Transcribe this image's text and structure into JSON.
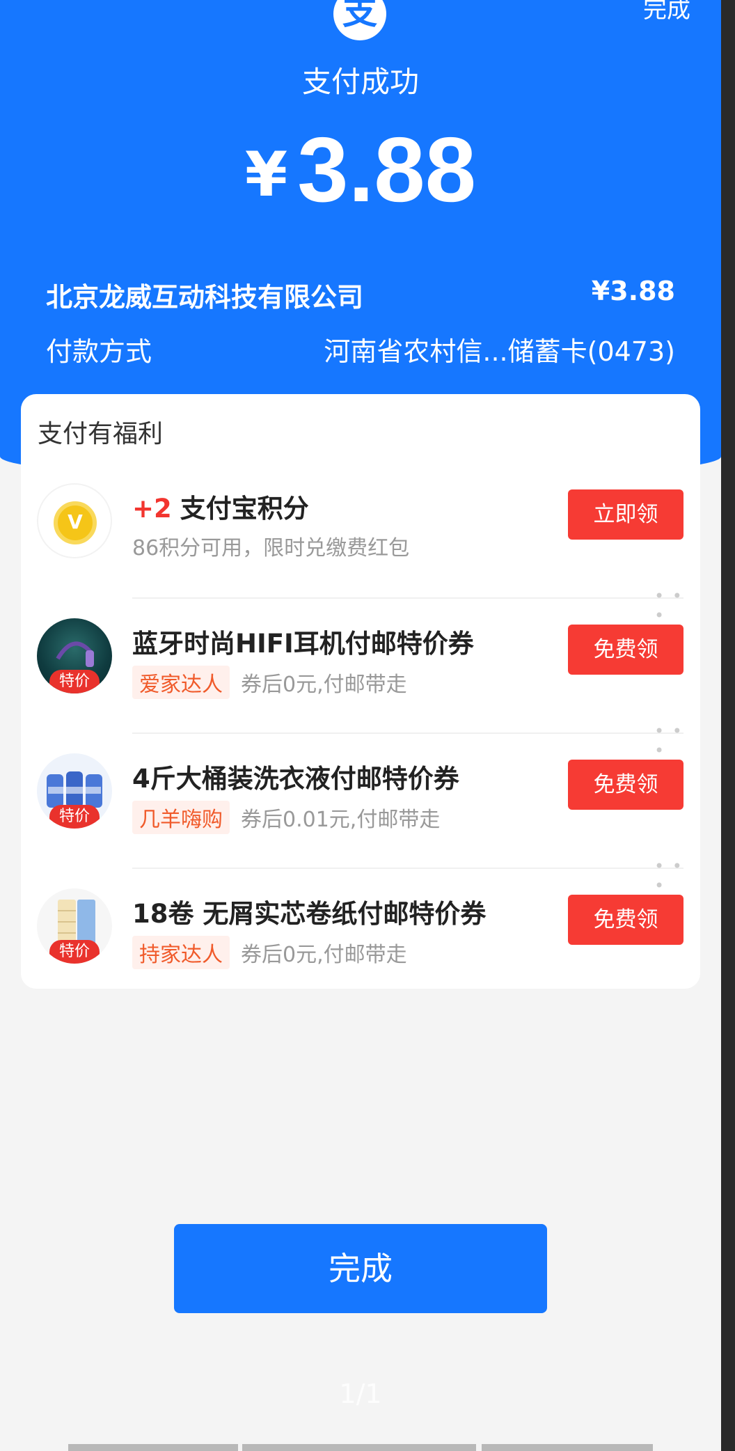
{
  "header": {
    "logo_char": "支",
    "top_done": "完成",
    "status": "支付成功",
    "currency": "¥",
    "amount": "3.88"
  },
  "details": {
    "merchant": "北京龙威互动科技有限公司",
    "merchant_amount": "¥3.88",
    "method_label": "付款方式",
    "method_value": "河南省农村信...储蓄卡(0473)"
  },
  "benefits": {
    "title": "支付有福利",
    "items": [
      {
        "plus": "+2",
        "title": "支付宝积分",
        "sub": "86积分可用，限时兑缴费红包",
        "button": "立即领"
      },
      {
        "title": "蓝牙时尚HIFI耳机付邮特价券",
        "store": "爱家达人",
        "sub": "券后0元,付邮带走",
        "tag": "特价",
        "button": "免费领"
      },
      {
        "title": "4斤大桶装洗衣液付邮特价券",
        "store": "几羊嗨购",
        "sub": "券后0.01元,付邮带走",
        "tag": "特价",
        "button": "免费领"
      },
      {
        "title": "18卷 无屑实芯卷纸付邮特价券",
        "store": "持家达人",
        "sub": "券后0元,付邮带走",
        "tag": "特价",
        "button": "免费领"
      }
    ]
  },
  "footer": {
    "done_label": "完成",
    "pager": "1/1"
  },
  "colors": {
    "primary": "#1677ff",
    "accent": "#f63b34"
  }
}
